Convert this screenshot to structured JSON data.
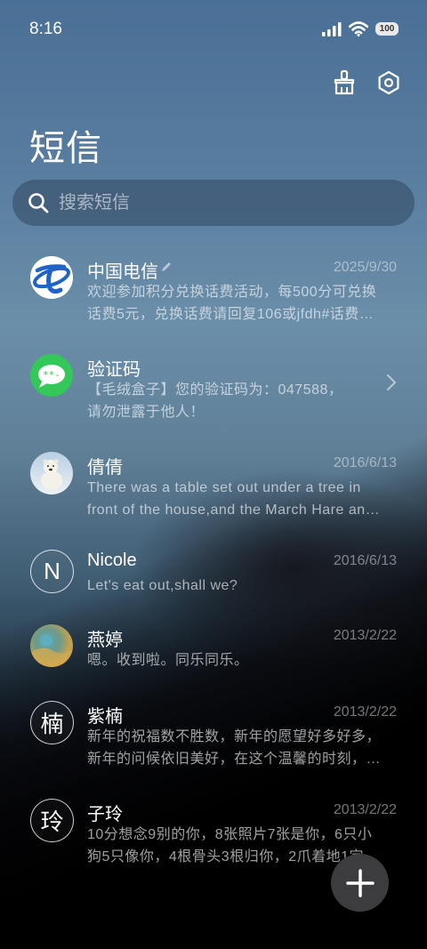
{
  "status_bar": {
    "time": "8:16",
    "battery": "100"
  },
  "header": {
    "title": "短信",
    "clean_icon": "brush-icon",
    "settings_icon": "settings-icon"
  },
  "search": {
    "placeholder": "搜索短信"
  },
  "conversations": [
    {
      "name": "中国电信",
      "date": "2025/9/30",
      "line1": "欢迎参加积分兑换话费活动，每500分可兑换",
      "line2": "话费5元，兑换话费请回复106或jfdh#话费…"
    },
    {
      "name": "验证码",
      "date": "",
      "line1": "【毛绒盒子】您的验证码为：047588，",
      "line2": "请勿泄露于他人！"
    },
    {
      "name": "倩倩",
      "date": "2016/6/13",
      "line1": "There was a table set out under a tree in",
      "line2": "front of the house,and the March Hare an…"
    },
    {
      "name": "Nicole",
      "initial": "N",
      "date": "2016/6/13",
      "line1": "Let's eat out,shall we?",
      "line2": ""
    },
    {
      "name": "燕婷",
      "date": "2013/2/22",
      "line1": "嗯。收到啦。同乐同乐。",
      "line2": ""
    },
    {
      "name": "紫楠",
      "initial": "楠",
      "date": "2013/2/22",
      "line1": "新年的祝福数不胜数，新年的愿望好多好多，",
      "line2": "新年的问候依旧美好，在这个温馨的时刻，…"
    },
    {
      "name": "子玲",
      "initial": "玲",
      "date": "2013/2/22",
      "line1": "10分想念9别的你，8张照片7张是你，6只小",
      "line2": "狗5只像你，4根骨头3根归你，2爪着地1定…"
    }
  ],
  "fab": {
    "icon": "plus-icon"
  },
  "colors": {
    "telecom_blue": "#1f63c8",
    "message_green": "#34c759"
  }
}
